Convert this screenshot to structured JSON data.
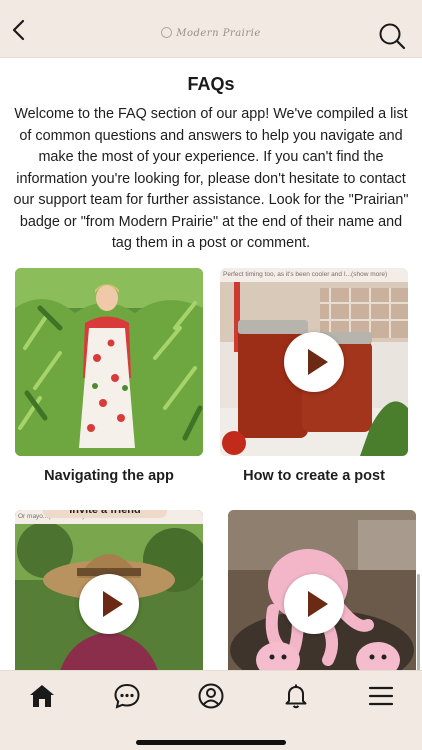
{
  "header": {
    "back_label": "Back",
    "brand_text": "Modern Prairie",
    "search_label": "Search"
  },
  "main": {
    "title": "FAQs",
    "intro": "Welcome to the FAQ section of our app! We've compiled a list of common questions and answers to help you navigate and make the most of your experience. If you can't find the information you're looking for, please don't hesitate to contact our support team for further assistance. Look for the \"Prairian\" badge or \"from Modern Prairie\" at the end of their name and tag them in a post or comment.",
    "cards": [
      {
        "label": "Navigating the app",
        "has_play": false,
        "caption": "",
        "pill": ""
      },
      {
        "label": "How to create a post",
        "has_play": true,
        "caption": "Perfect timing too, as it's been cooler and I...(show more)",
        "pill": ""
      },
      {
        "label": "",
        "has_play": true,
        "caption": "Or mayo...(show more)",
        "pill": "Invite a friend"
      },
      {
        "label": "",
        "has_play": true,
        "caption": "",
        "pill": ""
      }
    ]
  },
  "tabbar": {
    "items": [
      {
        "name": "home",
        "icon": "home-icon",
        "active": true
      },
      {
        "name": "messages",
        "icon": "chat-bubble-icon",
        "active": false
      },
      {
        "name": "profile",
        "icon": "user-circle-icon",
        "active": false
      },
      {
        "name": "notifications",
        "icon": "bell-icon",
        "active": false
      },
      {
        "name": "menu",
        "icon": "hamburger-menu-icon",
        "active": false
      }
    ]
  },
  "colors": {
    "bar_background": "#f2e9e2",
    "text": "#1e1e1e",
    "play_triangle": "#6a2a14",
    "icon": "#1a1a1a"
  }
}
